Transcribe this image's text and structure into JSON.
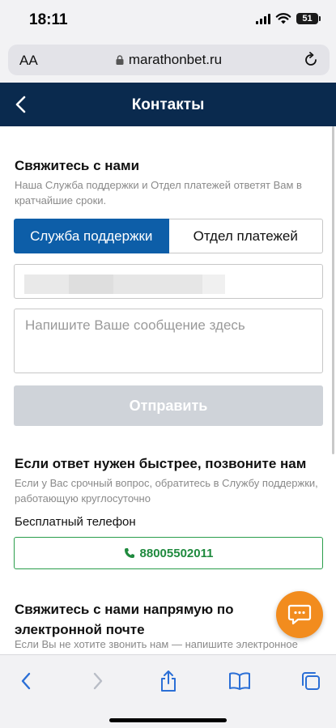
{
  "status_bar": {
    "time": "18:11",
    "battery": "51"
  },
  "browser": {
    "aa_label": "AA",
    "url": "marathonbet.ru"
  },
  "header": {
    "title": "Контакты"
  },
  "contact": {
    "title": "Свяжитесь с нами",
    "subtitle": "Наша Служба поддержки и Отдел платежей ответят Вам в кратчайшие сроки.",
    "tabs": [
      "Служба поддержки",
      "Отдел платежей"
    ],
    "message_placeholder": "Напишите Ваше сообщение здесь",
    "send_label": "Отправить"
  },
  "phone_section": {
    "title": "Если ответ нужен быстрее, позвоните нам",
    "subtitle": "Если у Вас срочный вопрос, обратитесь в Службу поддержки, работающую круглосуточно",
    "phone_label": "Бесплатный телефон",
    "phone_number": "88005502011"
  },
  "email_section": {
    "title": "Свяжитесь с нами напрямую по электронной почте",
    "subtitle": "Если Вы не хотите звонить нам — напишите электронное письмо"
  },
  "colors": {
    "header": "#0a2a4e",
    "accent": "#0d5ea8",
    "phone": "#1f8a3e",
    "chat": "#f28c1e"
  },
  "icons": [
    "back-chevron-icon",
    "lock-icon",
    "reload-icon",
    "phone-icon",
    "chat-icon",
    "share-icon",
    "bookmarks-icon",
    "tabs-icon"
  ]
}
